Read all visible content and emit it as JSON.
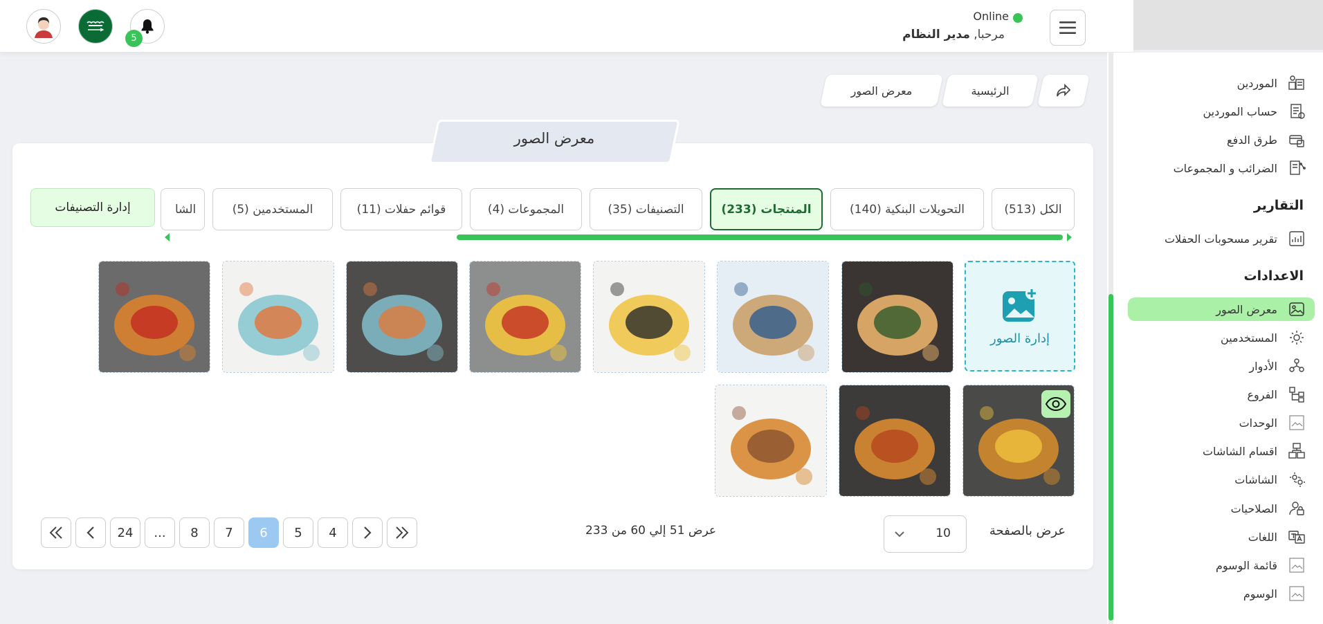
{
  "header": {
    "status": "Online",
    "greeting": "مرحبا,",
    "user_name": "مدير النظام",
    "notification_count": "5"
  },
  "sidebar": {
    "items_top": [
      {
        "label": "الموردين",
        "icon": "supplier-icon"
      },
      {
        "label": "حساب الموردين",
        "icon": "supplier-account-icon"
      },
      {
        "label": "طرق الدفع",
        "icon": "payment-icon"
      },
      {
        "label": "الضرائب و المجموعات",
        "icon": "tax-icon"
      }
    ],
    "reports_heading": "التقارير",
    "reports": [
      {
        "label": "تقرير مسحوبات الحفلات",
        "icon": "report-icon"
      }
    ],
    "settings_heading": "الاعدادات",
    "settings": [
      {
        "label": "معرض الصور",
        "icon": "gallery-icon"
      },
      {
        "label": "المستخدمين",
        "icon": "users-icon"
      },
      {
        "label": "الأدوار",
        "icon": "roles-icon"
      },
      {
        "label": "الفروع",
        "icon": "branches-icon"
      },
      {
        "label": "الوحدات",
        "icon": "broken-image-icon"
      },
      {
        "label": "اقسام الشاشات",
        "icon": "screen-sections-icon"
      },
      {
        "label": "الشاشات",
        "icon": "screens-icon"
      },
      {
        "label": "الصلاحيات",
        "icon": "permissions-icon"
      },
      {
        "label": "اللغات",
        "icon": "languages-icon"
      },
      {
        "label": "قائمة الوسوم",
        "icon": "broken-image-icon"
      },
      {
        "label": "الوسوم",
        "icon": "broken-image-icon"
      }
    ]
  },
  "breadcrumb": {
    "home": "الرئيسية",
    "current": "معرض الصور"
  },
  "page": {
    "title": "معرض الصور",
    "manage_categories": "إدارة التصنيفات",
    "manage_images": "إدارة الصور"
  },
  "tabs": [
    "الكل (513)",
    "التحويلات البنكية (140)",
    "المنتجات (233)",
    "التصنيفات (35)",
    "المجموعات (4)",
    "قوائم حفلات (11)",
    "المستخدمين (5)",
    "الشا"
  ],
  "gallery": [
    {
      "name": "pide-flatbread",
      "colors": [
        "#3a3433",
        "#e8b16a",
        "#2f5a2a"
      ]
    },
    {
      "name": "pasta-plate",
      "colors": [
        "#e6eef5",
        "#caa06b",
        "#2e5b8f"
      ]
    },
    {
      "name": "biryani-pan",
      "colors": [
        "#f3f3f1",
        "#f0c74a",
        "#2b2b2b"
      ]
    },
    {
      "name": "fries-sauces",
      "colors": [
        "#8d8f8f",
        "#f0c23d",
        "#c43024"
      ]
    },
    {
      "name": "shrimp-cup",
      "colors": [
        "#4f4d4b",
        "#7fb8c4",
        "#e07a3c"
      ]
    },
    {
      "name": "shrimp-plate",
      "colors": [
        "#f2f2f0",
        "#8cc8d0",
        "#e2753a"
      ]
    },
    {
      "name": "sausage-board",
      "colors": [
        "#6b6b6b",
        "#d9822f",
        "#c42a1f"
      ]
    },
    {
      "name": "burger-fries",
      "colors": [
        "#4a4a48",
        "#d18a2c",
        "#f0c23d"
      ]
    },
    {
      "name": "slider-trio",
      "colors": [
        "#3d3b39",
        "#d88a32",
        "#b6451d"
      ]
    },
    {
      "name": "slider-board",
      "colors": [
        "#f4f4f2",
        "#d88a32",
        "#8a5330"
      ]
    }
  ],
  "pagination": {
    "per_page_label": "عرض بالصفحة",
    "per_page_value": "10",
    "summary": "عرض 51 إلي 60 من 233",
    "pages": [
      "24",
      "...",
      "8",
      "7",
      "6",
      "5",
      "4"
    ],
    "current": "6"
  },
  "colors": {
    "accent_green": "#39c45a",
    "active_tab_bg": "#e5fde2",
    "active_tab_border": "#1f6b33",
    "current_page": "#9cc9f2"
  }
}
